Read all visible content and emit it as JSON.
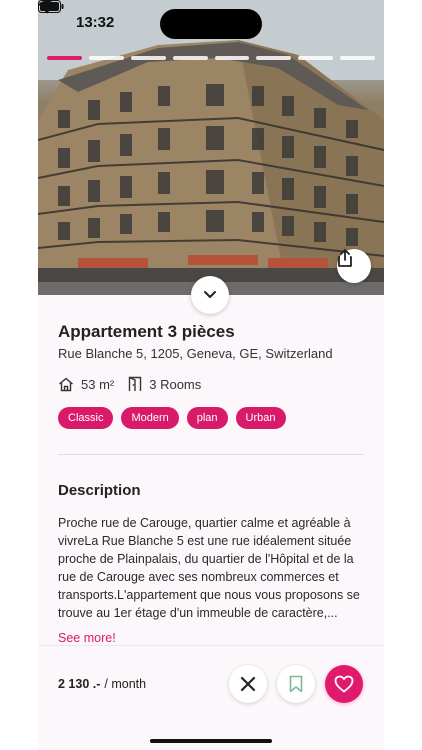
{
  "status_bar": {
    "time": "13:32"
  },
  "gallery": {
    "segments": 8,
    "active_index": 0
  },
  "listing": {
    "title": "Appartement 3 pièces",
    "address": "Rue Blanche 5, 1205, Geneva, GE, Switzerland",
    "area": "53 m²",
    "rooms": "3 Rooms",
    "tags": [
      "Classic",
      "Modern",
      "plan",
      "Urban"
    ]
  },
  "description": {
    "heading": "Description",
    "text": "Proche rue de Carouge, quartier calme et agréable à vivreLa Rue Blanche 5 est une rue idéalement située proche de Plainpalais, du quartier de l'Hôpital et de la rue de Carouge avec ses nombreux commerces et transports.L'appartement que nous vous proposons se trouve au 1er étage d'un immeuble de caractère,...",
    "see_more": "See more!"
  },
  "pricing": {
    "amount": "2 130 .-",
    "period": "/ month"
  },
  "icons": {
    "share": "share-icon",
    "collapse": "chevron-down-icon",
    "area": "home-icon",
    "rooms": "door-icon",
    "dismiss": "close-icon",
    "bookmark": "bookmark-icon",
    "like": "heart-icon"
  },
  "colors": {
    "accent": "#e01a6d",
    "background": "#fcf7fb"
  }
}
